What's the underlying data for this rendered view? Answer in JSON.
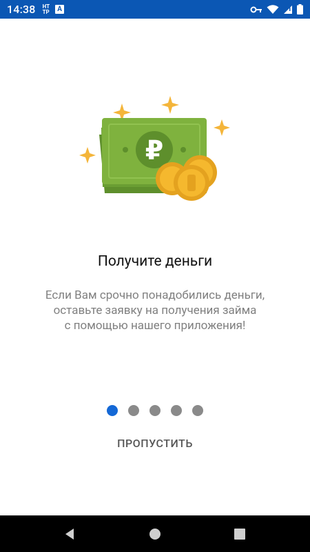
{
  "status_bar": {
    "time": "14:38",
    "net_label_top": "HT",
    "net_label_bottom": "TP",
    "badge_letter": "A",
    "icons": [
      "key-icon",
      "wifi-icon",
      "signal-icon",
      "battery-icon"
    ]
  },
  "onboarding": {
    "title": "Получите деньги",
    "description_lines": [
      "Если Вам срочно понадобились деньги,",
      "оставьте заявку на получения займа",
      "с помощью нашего приложения!"
    ],
    "currency_symbol": "₽",
    "page_count": 5,
    "active_page": 1,
    "skip_label": "ПРОПУСТИТЬ"
  },
  "nav_bar": {
    "buttons": [
      "back",
      "home",
      "recents"
    ]
  },
  "colors": {
    "status_bar": "#0b57b4",
    "active_dot": "#1468d6",
    "inactive_dot": "#8a8a8a",
    "money_green": "#7fb23e",
    "coin_gold": "#f5b82e",
    "sparkle": "#f4b53a"
  }
}
